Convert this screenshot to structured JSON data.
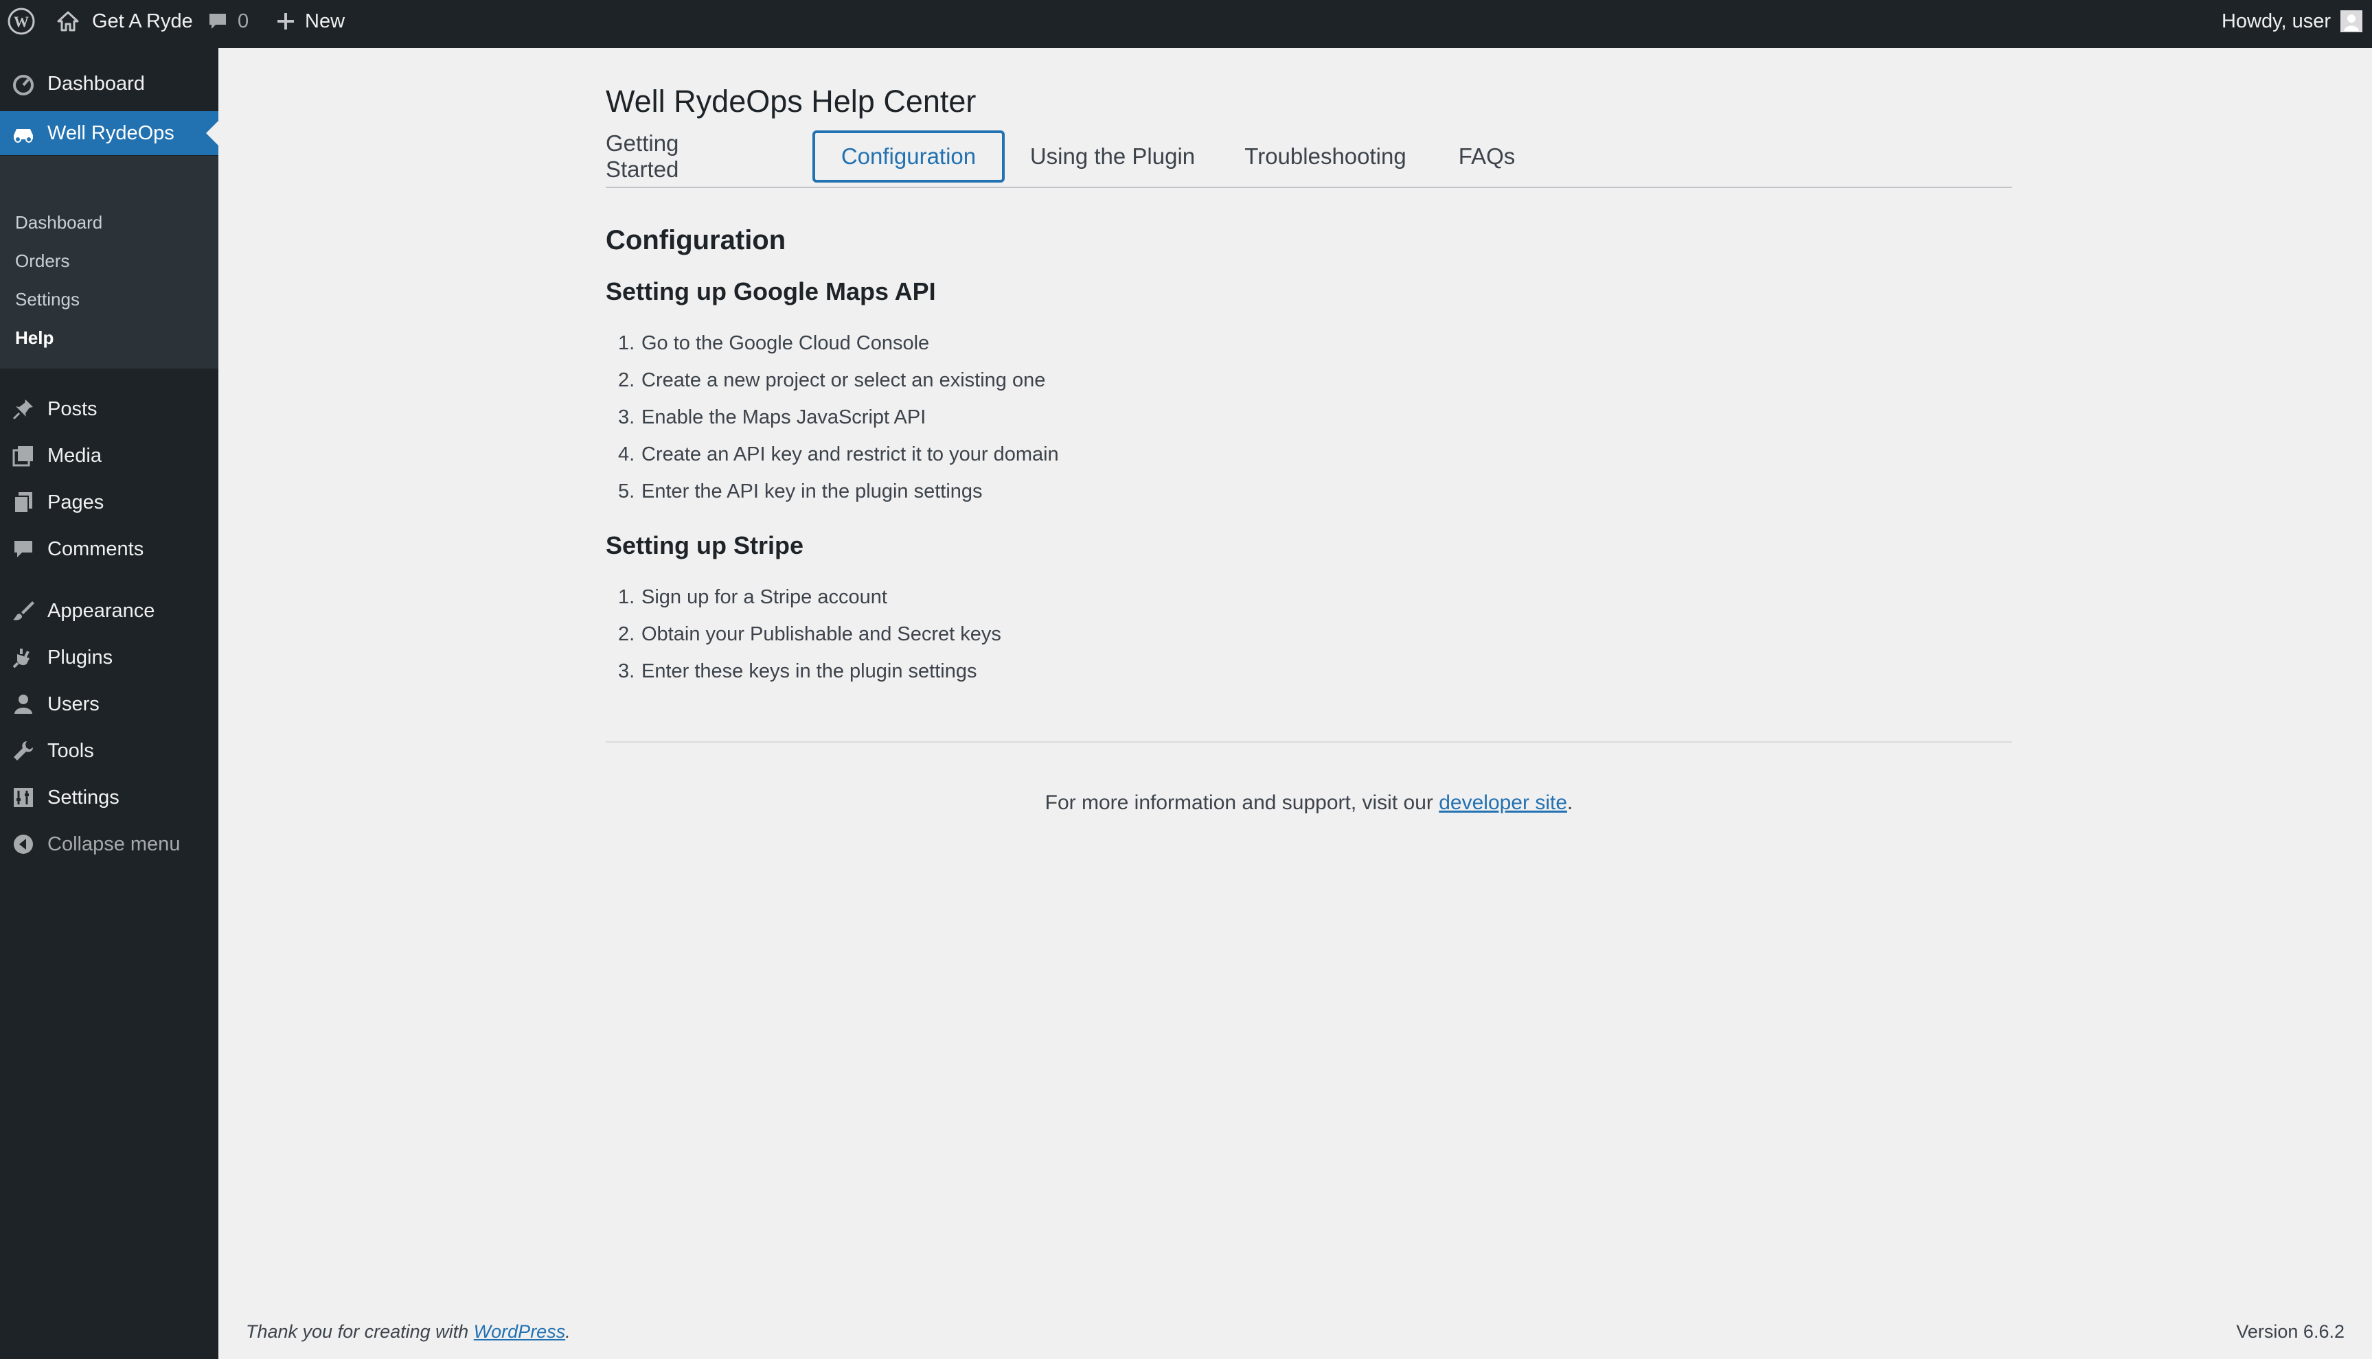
{
  "adminbar": {
    "site_name": "Get A Ryde",
    "comments_count": "0",
    "new_label": "New",
    "howdy": "Howdy, user"
  },
  "sidebar": {
    "items": [
      {
        "label": "Dashboard",
        "icon": "dashboard-icon"
      },
      {
        "label": "Well RydeOps",
        "icon": "car-icon",
        "current": true
      },
      {
        "label": "Posts",
        "icon": "pin-icon"
      },
      {
        "label": "Media",
        "icon": "media-icon"
      },
      {
        "label": "Pages",
        "icon": "pages-icon"
      },
      {
        "label": "Comments",
        "icon": "comment-icon"
      },
      {
        "label": "Appearance",
        "icon": "brush-icon"
      },
      {
        "label": "Plugins",
        "icon": "plugin-icon"
      },
      {
        "label": "Users",
        "icon": "user-icon"
      },
      {
        "label": "Tools",
        "icon": "wrench-icon"
      },
      {
        "label": "Settings",
        "icon": "settings-icon"
      },
      {
        "label": "Collapse menu",
        "icon": "collapse-icon"
      }
    ],
    "submenu": [
      "Dashboard",
      "Orders",
      "Settings",
      "Help"
    ]
  },
  "main": {
    "title": "Well RydeOps Help Center",
    "tabs": [
      "Getting Started",
      "Configuration",
      "Using the Plugin",
      "Troubleshooting",
      "FAQs"
    ],
    "active_tab": "Configuration",
    "section_title": "Configuration",
    "maps": {
      "heading": "Setting up Google Maps API",
      "steps": [
        "Go to the Google Cloud Console",
        "Create a new project or select an existing one",
        "Enable the Maps JavaScript API",
        "Create an API key and restrict it to your domain",
        "Enter the API key in the plugin settings"
      ]
    },
    "stripe": {
      "heading": "Setting up Stripe",
      "steps": [
        "Sign up for a Stripe account",
        "Obtain your Publishable and Secret keys",
        "Enter these keys in the plugin settings"
      ]
    },
    "support": {
      "prefix": "For more information and support, visit our ",
      "link_text": "developer site",
      "suffix": "."
    }
  },
  "footer": {
    "thanks_prefix": "Thank you for creating with ",
    "thanks_link": "WordPress",
    "thanks_suffix": ".",
    "version": "Version 6.6.2"
  },
  "colors": {
    "admin_dark": "#1d2327",
    "submenu_bg": "#2c3338",
    "accent": "#2271b1",
    "page_bg": "#f0f0f1"
  }
}
